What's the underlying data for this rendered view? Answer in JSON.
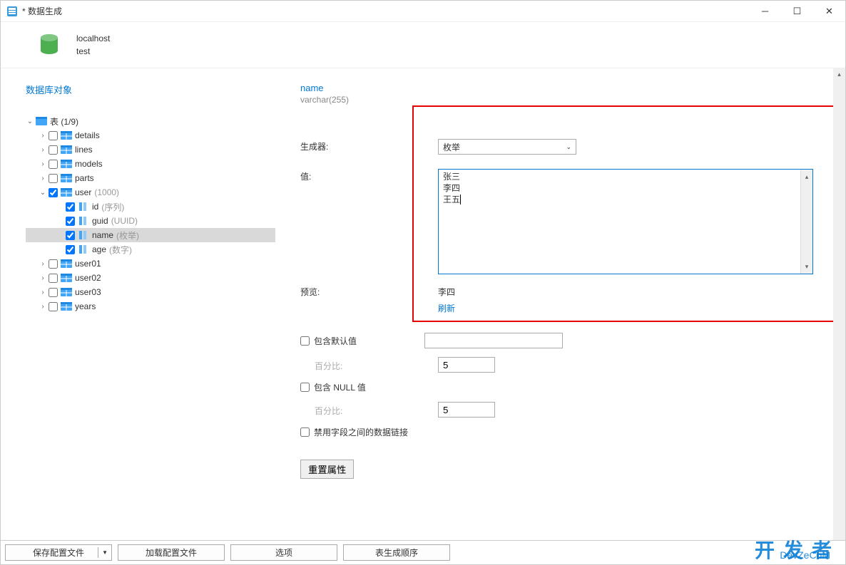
{
  "window": {
    "title": "* 数据生成"
  },
  "header": {
    "host": "localhost",
    "db": "test"
  },
  "left": {
    "section_title": "数据库对象",
    "root_label": "表 (1/9)",
    "tables": [
      {
        "label": "details"
      },
      {
        "label": "lines"
      },
      {
        "label": "models"
      },
      {
        "label": "parts"
      },
      {
        "label": "user",
        "note": "(1000)",
        "checked": true,
        "expanded": true
      },
      {
        "label": "user01"
      },
      {
        "label": "user02"
      },
      {
        "label": "user03"
      },
      {
        "label": "years"
      }
    ],
    "columns": [
      {
        "label": "id",
        "note": "(序列)"
      },
      {
        "label": "guid",
        "note": "(UUID)"
      },
      {
        "label": "name",
        "note": "(枚举)",
        "selected": true
      },
      {
        "label": "age",
        "note": "(数字)"
      }
    ]
  },
  "right": {
    "field_name": "name",
    "field_type": "varchar(255)",
    "generator_label": "生成器:",
    "generator_value": "枚举",
    "values_label": "值:",
    "values_text": "张三\n李四\n王五",
    "preview_label": "预览:",
    "preview_value": "李四",
    "refresh": "刷新",
    "include_default": "包含默认值",
    "percent_label": "百分比:",
    "percent_default": "5",
    "include_null": "包含 NULL 值",
    "percent_null": "5",
    "disable_link": "禁用字段之间的数据链接",
    "reset": "重置属性"
  },
  "bottom": {
    "save": "保存配置文件",
    "load": "加载配置文件",
    "options": "选项",
    "order": "表生成顺序"
  },
  "watermark": {
    "cn": "开发者",
    "en": "DevZeCoM"
  }
}
